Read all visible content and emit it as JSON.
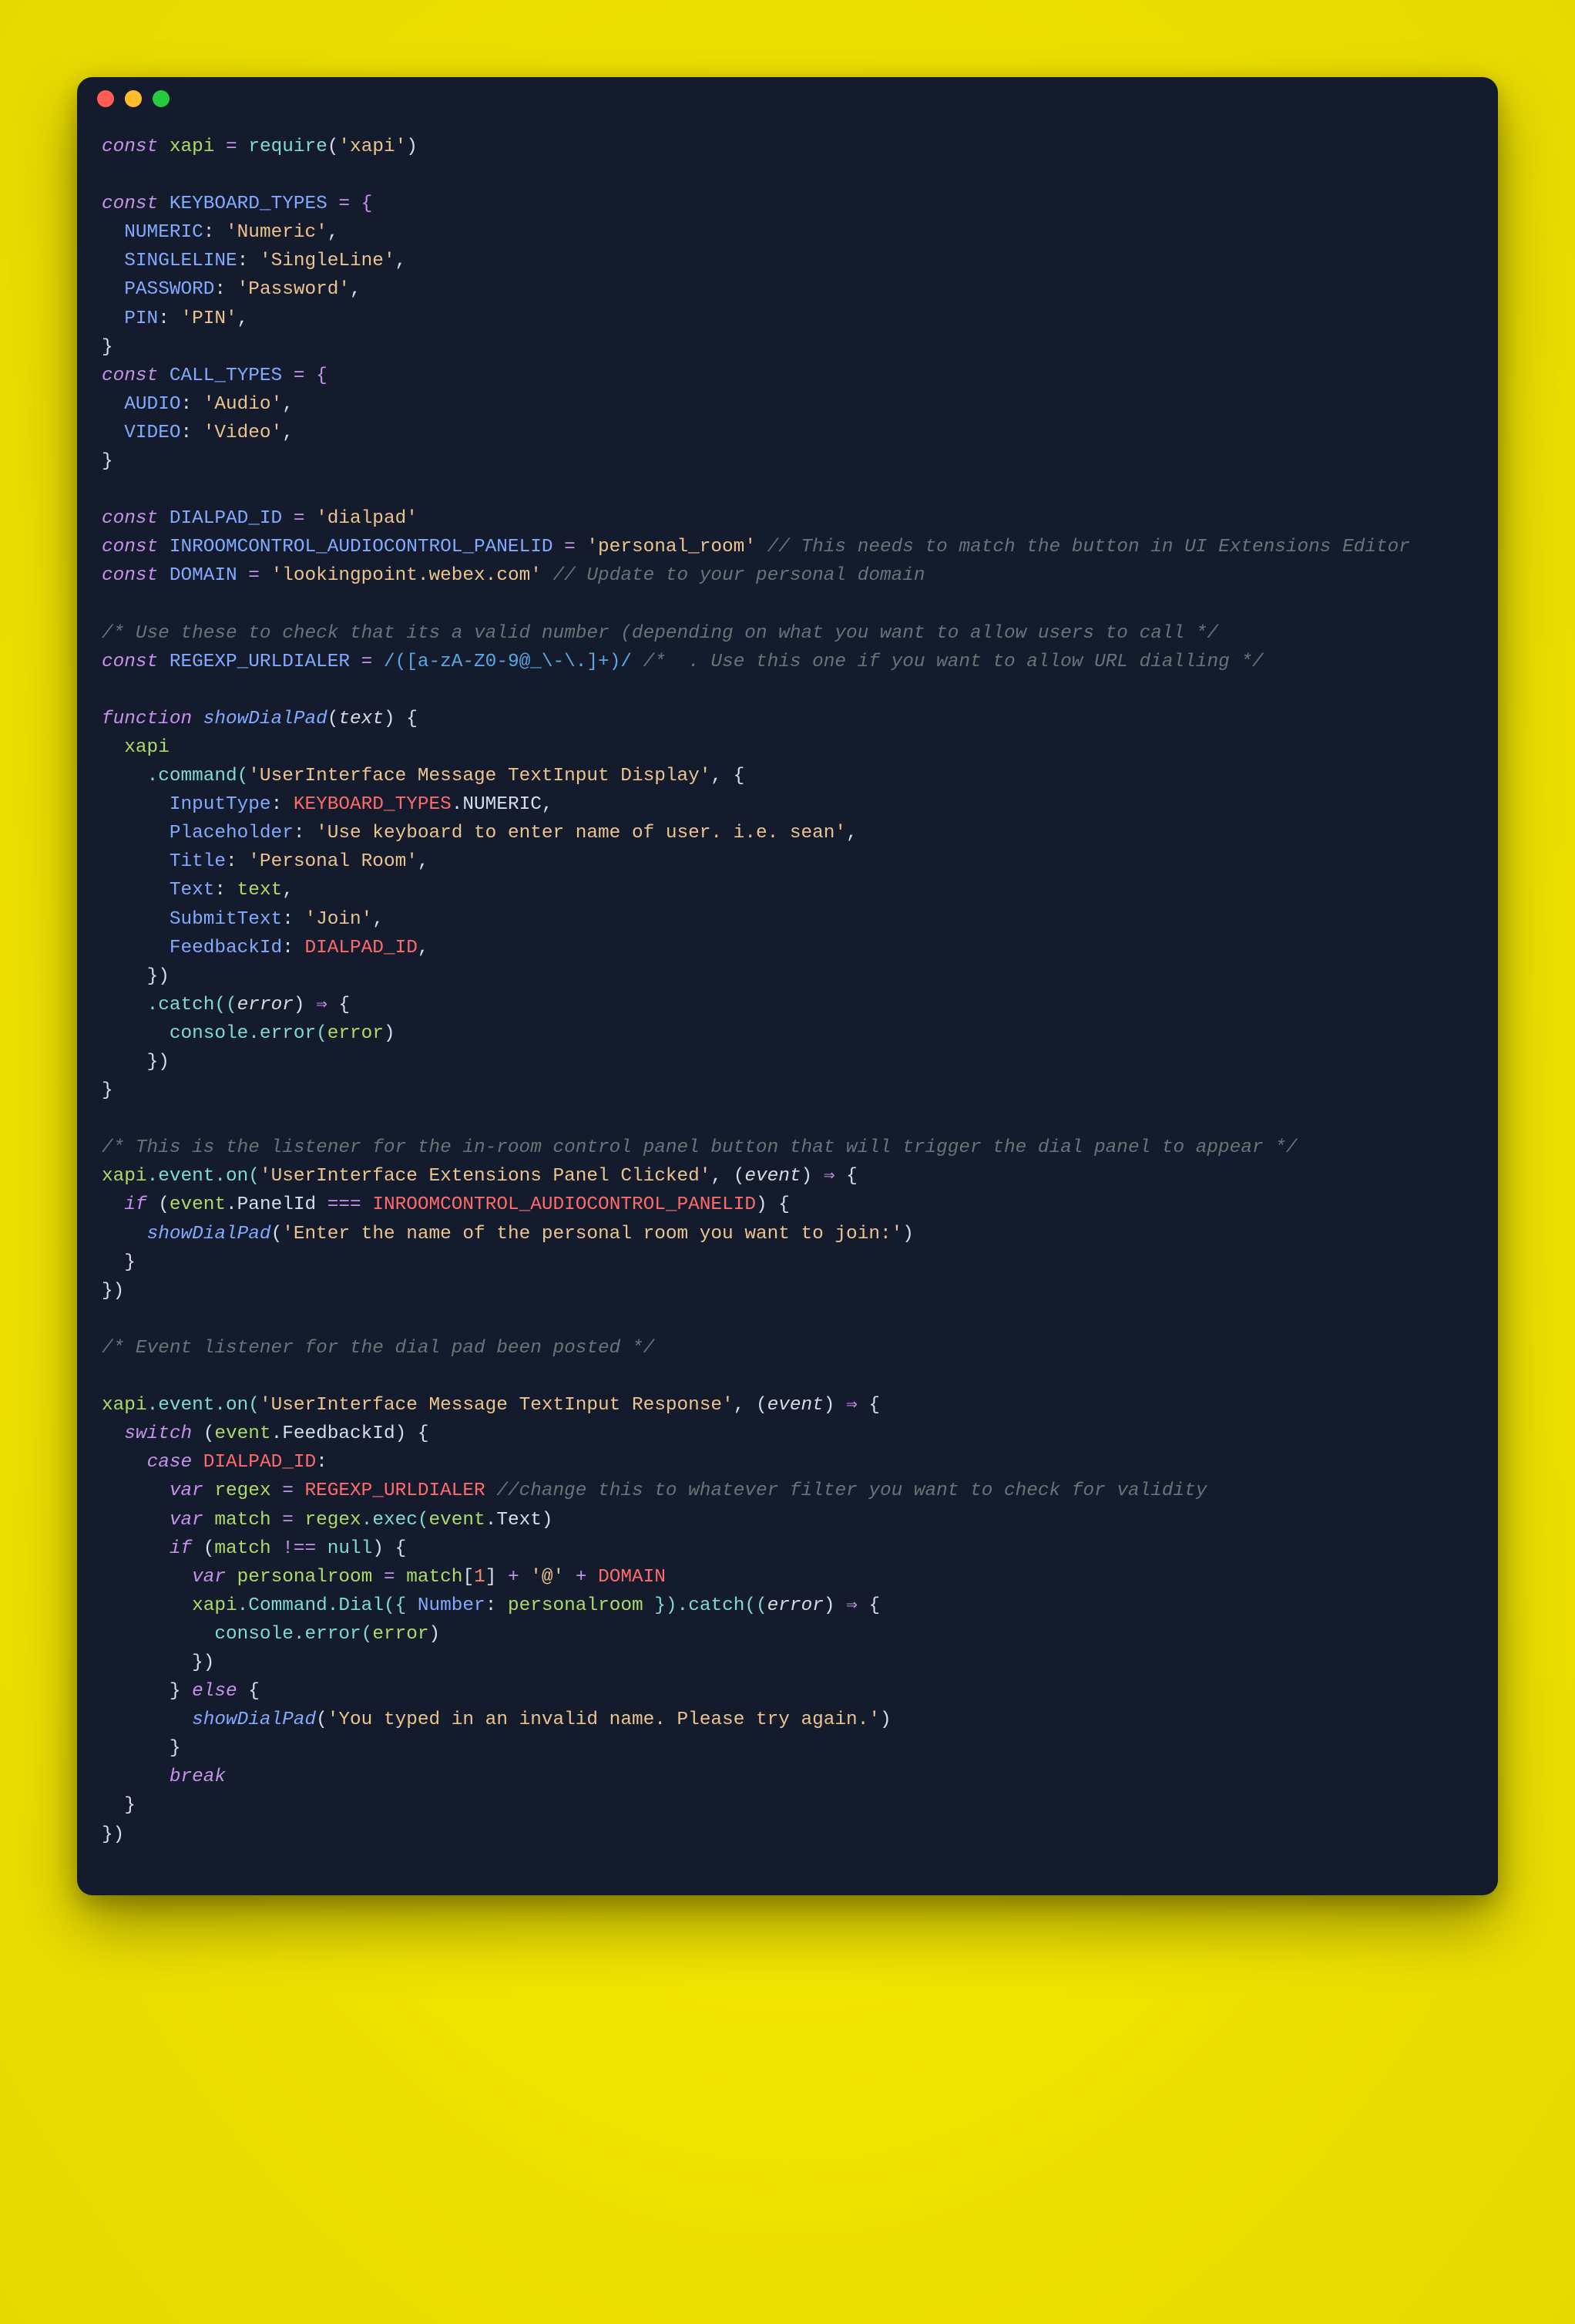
{
  "window": {
    "dots": [
      "red",
      "yellow",
      "green"
    ]
  },
  "code": {
    "l1_const": "const",
    "l1_xapi": "xapi",
    "l1_eq": " = ",
    "l1_require": "require",
    "l1_paren_o": "(",
    "l1_str": "'xapi'",
    "l1_paren_c": ")",
    "kb_const": "const",
    "kb_name": "KEYBOARD_TYPES",
    "kb_eq": " = {",
    "kb_numeric_k": "NUMERIC",
    "kb_numeric_v": "'Numeric'",
    "kb_single_k": "SINGLELINE",
    "kb_single_v": "'SingleLine'",
    "kb_pass_k": "PASSWORD",
    "kb_pass_v": "'Password'",
    "kb_pin_k": "PIN",
    "kb_pin_v": "'PIN'",
    "ct_const": "const",
    "ct_name": "CALL_TYPES",
    "ct_eq": " = {",
    "ct_audio_k": "AUDIO",
    "ct_audio_v": "'Audio'",
    "ct_video_k": "VIDEO",
    "ct_video_v": "'Video'",
    "dp_const": "const",
    "dp_name": "DIALPAD_ID",
    "dp_eq": " = ",
    "dp_val": "'dialpad'",
    "ir_const": "const",
    "ir_name": "INROOMCONTROL_AUDIOCONTROL_PANELID",
    "ir_eq": " = ",
    "ir_val": "'personal_room'",
    "ir_cm": " // This needs to match the button in UI Extensions Editor",
    "dm_const": "const",
    "dm_name": "DOMAIN",
    "dm_eq": " = ",
    "dm_val": "'lookingpoint.webex.com'",
    "dm_cm": " // Update to your personal domain",
    "cm_valid": "/* Use these to check that its a valid number (depending on what you want to allow users to call */",
    "rx_const": "const",
    "rx_name": "REGEXP_URLDIALER",
    "rx_eq": " = ",
    "rx_val": "/([a-zA-Z0-9@_\\-\\.]+)/",
    "rx_cm": " /*  . Use this one if you want to allow URL dialling */",
    "fn_kw": "function",
    "fn_name": "showDialPad",
    "fn_paren_o": "(",
    "fn_param": "text",
    "fn_paren_c": ") {",
    "x_ident": "xapi",
    "x_cmd": ".command(",
    "x_cmd_str": "'UserInterface Message TextInput Display'",
    "x_cmd_c": ", {",
    "it_k": "InputType",
    "it_v1": "KEYBOARD_TYPES",
    "it_v2": ".NUMERIC,",
    "ph_k": "Placeholder",
    "ph_v": "'Use keyboard to enter name of user. i.e. sean'",
    "ti_k": "Title",
    "ti_v": "'Personal Room'",
    "tx_k": "Text",
    "tx_v": "text",
    "st_k": "SubmitText",
    "st_v": "'Join'",
    "fb_k": "FeedbackId",
    "fb_v": "DIALPAD_ID",
    "cmd_close": "})",
    "catch": ".catch((",
    "catch_p": "error",
    "catch_c": ") ",
    "arrow": "⇒",
    "catch_o": " {",
    "cons": "console",
    "cons_err": ".error(",
    "cons_arg": "error",
    "cons_c": ")",
    "catch_close": "})",
    "cm_listener": "/* This is the listener for the in-room control panel button that will trigger the dial panel to appear */",
    "ev1_x": "xapi",
    "ev1_ev": ".event.on(",
    "ev1_str": "'UserInterface Extensions Panel Clicked'",
    "ev1_c": ", (",
    "ev1_p": "event",
    "ev1_c2": ") ",
    "ev1_o": " {",
    "if_kw": "if",
    "if_o": " (",
    "ev_ident": "event",
    "ev_pid": ".PanelId ",
    "eqeq": "===",
    "if_rhs": " INROOMCONTROL_AUDIOCONTROL_PANELID",
    "if_c": ") {",
    "call_sdp": "showDialPad",
    "call_sdp_o": "(",
    "call_sdp_s": "'Enter the name of the personal room you want to join:'",
    "call_sdp_c": ")",
    "cm_ev2": "/* Event listener for the dial pad been posted */",
    "ev2_x": "xapi",
    "ev2_ev": ".event.on(",
    "ev2_str": "'UserInterface Message TextInput Response'",
    "ev2_c": ", (",
    "ev2_p": "event",
    "ev2_c2": ") ",
    "ev2_o": " {",
    "sw_kw": "switch",
    "sw_o": " (",
    "sw_e": "event",
    "sw_f": ".FeedbackId) {",
    "case_kw": "case",
    "case_v": " DIALPAD_ID",
    "case_c": ":",
    "var1": "var",
    "rg_name": "regex",
    "rg_eq": " = ",
    "rg_v": "REGEXP_URLDIALER",
    "rg_cm": " //change this to whatever filter you want to check for validity",
    "var2": "var",
    "mt_name": "match",
    "mt_eq": " = ",
    "mt_rhs1": "regex",
    "mt_rhs2": ".exec(",
    "mt_rhs3": "event",
    "mt_rhs4": ".Text)",
    "if2_kw": "if",
    "if2_o": " (",
    "if2_l": "match",
    "neq": " !== ",
    "null": "null",
    "if2_c": ") {",
    "var3": "var",
    "pr_name": "personalroom",
    "pr_eq": " = ",
    "pr_m": "match",
    "pr_idx_o": "[",
    "pr_idx": "1",
    "pr_idx_c": "] ",
    "plus1": "+",
    "at": " '@' ",
    "plus2": "+",
    "dom": " DOMAIN",
    "dial_x": "xapi",
    "dial_cmd": ".Command.Dial({ ",
    "dial_k": "Number",
    "dial_c1": ": ",
    "dial_v": "personalroom",
    "dial_c2": " }).catch((",
    "dial_p": "error",
    "dial_c3": ") ",
    "dial_o": " {",
    "cons2": "console",
    "cons2e": ".error(",
    "cons2a": "error",
    "cons2c": ")",
    "else_kw": "else",
    "else_o": " {",
    "else_fn": "showDialPad",
    "else_fo": "(",
    "else_s": "'You typed in an invalid name. Please try again.'",
    "else_fc": ")",
    "break_kw": "break",
    "closers": {
      "brace": "}",
      "bracep": "})"
    }
  }
}
